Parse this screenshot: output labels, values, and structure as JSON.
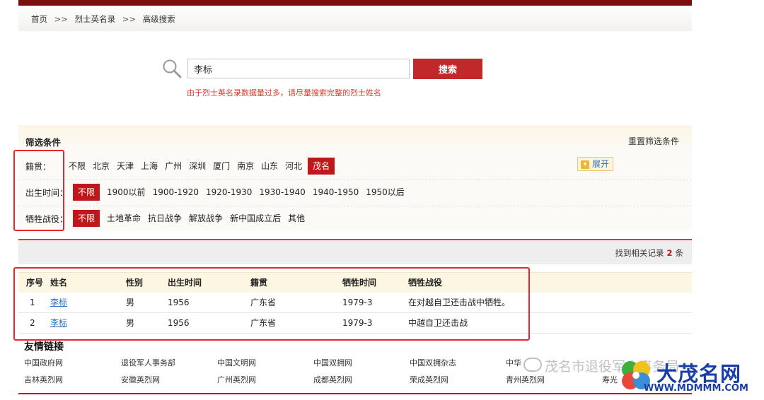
{
  "breadcrumb": [
    "首页",
    "烈士英名录",
    "高级搜索"
  ],
  "breadcrumb_sep": ">>",
  "search": {
    "value": "李标",
    "button_label": "搜索",
    "hint": "由于烈士英名录数据量过多，请尽量搜索完整的烈士姓名"
  },
  "filters": {
    "title": "筛选条件",
    "reset_label": "重置筛选条件",
    "expand_label": "展开",
    "rows": [
      {
        "label": "籍贯：",
        "options": [
          "不限",
          "北京",
          "天津",
          "上海",
          "广州",
          "深圳",
          "厦门",
          "南京",
          "山东",
          "河北",
          "茂名"
        ],
        "active": "茂名"
      },
      {
        "label": "出生时间：",
        "options": [
          "不限",
          "1900以前",
          "1900-1920",
          "1920-1930",
          "1930-1940",
          "1940-1950",
          "1950以后"
        ],
        "active": "不限"
      },
      {
        "label": "牺牲战役：",
        "options": [
          "不限",
          "土地革命",
          "抗日战争",
          "解放战争",
          "新中国成立后",
          "其他"
        ],
        "active": "不限"
      }
    ]
  },
  "results": {
    "count_prefix": "找到相关记录",
    "count": "2",
    "count_suffix": "条"
  },
  "table": {
    "headers": [
      "序号",
      "姓名",
      "性别",
      "出生时间",
      "籍贯",
      "牺牲时间",
      "牺牲战役"
    ],
    "rows": [
      [
        "1",
        "李标",
        "男",
        "1956",
        "广东省",
        "1979-3",
        "在对越自卫还击战中牺牲。"
      ],
      [
        "2",
        "李标",
        "男",
        "1956",
        "广东省",
        "1979-3",
        "中越自卫还击战"
      ]
    ]
  },
  "links": {
    "title": "友情链接",
    "items": [
      "中国政府网",
      "退役军人事务部",
      "中国文明网",
      "中国双拥网",
      "中国双拥杂志",
      "中华",
      "吉林英烈网",
      "安徽英烈网",
      "广州英烈网",
      "成都英烈网",
      "荣成英烈网",
      "青州英烈网",
      "寿光"
    ]
  },
  "watermark": {
    "wechat": "茂名市退役军人事务局",
    "logo_text": "大茂名网",
    "logo_url": "WWW.MDMMM.COM"
  },
  "colors": {
    "brand_red": "#c0171b",
    "topbar": "#7a0f0b",
    "link_blue": "#2a6cc6",
    "annotation_red": "#e8262c"
  }
}
